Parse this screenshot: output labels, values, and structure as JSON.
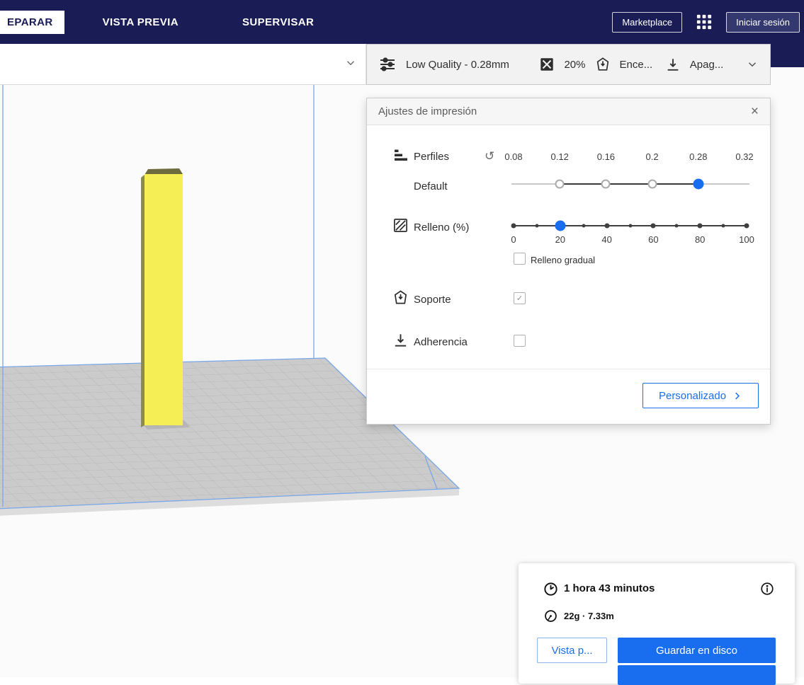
{
  "colors": {
    "accent": "#196ef0",
    "header_bg": "#1a1c55",
    "model_yellow": "#f5ee55"
  },
  "header": {
    "tabs": [
      {
        "label": "EPARAR",
        "active": true
      },
      {
        "label": "VISTA PREVIA",
        "active": false
      },
      {
        "label": "SUPERVISAR",
        "active": false
      }
    ],
    "marketplace_label": "Marketplace",
    "apps_icon": "grid-apps-icon",
    "sign_in_label": "Iniciar sesión"
  },
  "summary_bar": {
    "profile": "Low Quality - 0.28mm",
    "infill": "20%",
    "support": "Ence...",
    "adhesion": "Apag..."
  },
  "panel": {
    "title": "Ajustes de impresión",
    "close": "×",
    "profiles": {
      "label": "Perfiles",
      "reset_icon": "↺",
      "ticks": [
        "0.08",
        "0.12",
        "0.16",
        "0.2",
        "0.28",
        "0.32"
      ],
      "profile_name": "Default",
      "selected_value": "0.28",
      "available_values": [
        "0.12",
        "0.16",
        "0.2",
        "0.28"
      ]
    },
    "infill": {
      "label": "Relleno (%)",
      "ticks": [
        "0",
        "20",
        "40",
        "60",
        "80",
        "100"
      ],
      "value": 20,
      "gradual_label": "Relleno gradual",
      "gradual_enabled": false
    },
    "support_label": "Soporte",
    "support_enabled": true,
    "adhesion_label": "Adherencia",
    "adhesion_enabled": false,
    "custom_button": "Personalizado"
  },
  "output": {
    "print_time": "1 hora 43 minutos",
    "material_usage": "22g · 7.33m",
    "preview_button": "Vista p...",
    "save_button": "Guardar en disco"
  }
}
